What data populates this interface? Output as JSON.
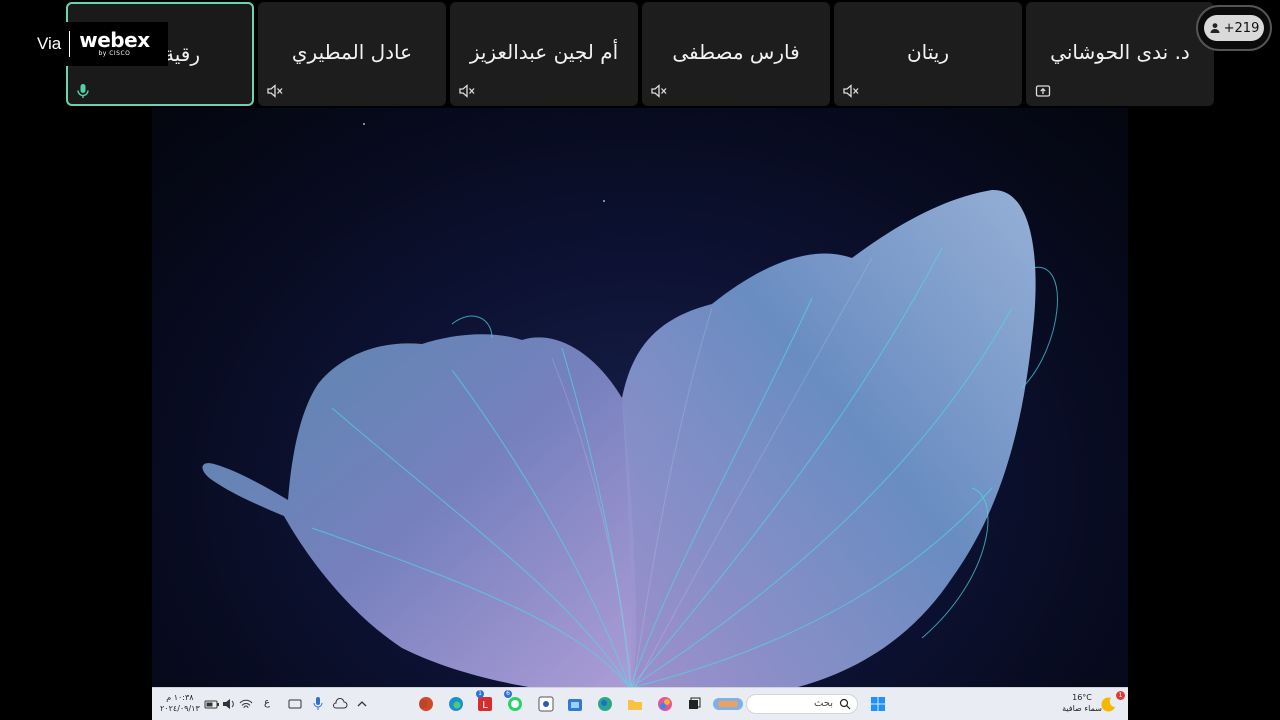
{
  "branding": {
    "via": "Via",
    "product": "webex",
    "sub": "by CISCO"
  },
  "participants": [
    {
      "name": "رقية",
      "status": "speaking",
      "mic_icon": "mic-on-icon"
    },
    {
      "name": "عادل المطيري",
      "status": "muted",
      "mic_icon": "speaker-muted-icon"
    },
    {
      "name": "أم لجين عبدالعزيز",
      "status": "muted",
      "mic_icon": "speaker-muted-icon"
    },
    {
      "name": "فارس مصطفى",
      "status": "muted",
      "mic_icon": "speaker-muted-icon"
    },
    {
      "name": "ريتان",
      "status": "muted",
      "mic_icon": "speaker-muted-icon"
    },
    {
      "name": "د. ندى الحوشاني",
      "status": "sharing",
      "mic_icon": "share-screen-icon"
    }
  ],
  "participant_count": "+219",
  "taskbar": {
    "search_placeholder": "بحث",
    "clock_time": "١٠:٣٨ م",
    "clock_date": "٢٠٢٤/٠٩/١٣",
    "input_lang": "ع",
    "weather_temp": "16°C",
    "weather_desc": "سماء صافية",
    "notification_badge": "1",
    "app_badge_1": "1",
    "app_badge_2": "6"
  },
  "colors": {
    "active_border": "#6bd3b4",
    "tile_bg": "#1d1d1d",
    "taskbar_bg": "#e9ecf2"
  }
}
